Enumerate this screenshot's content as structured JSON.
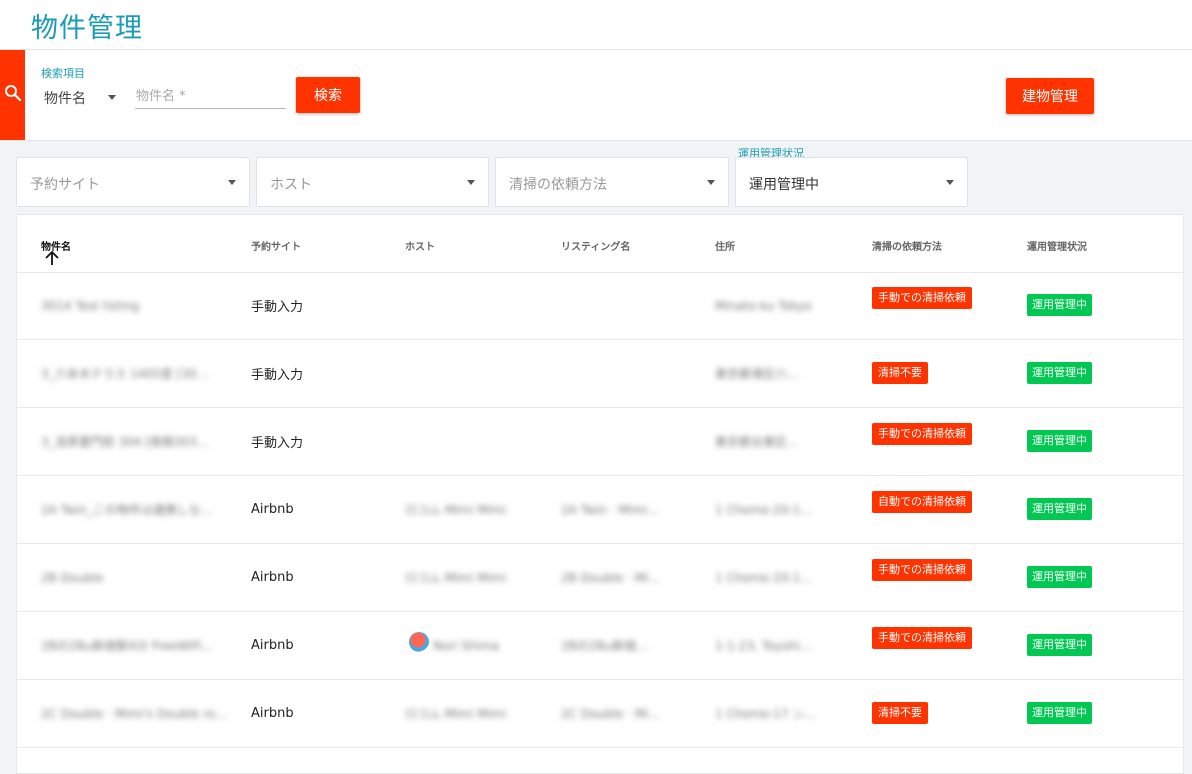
{
  "header": {
    "title": "物件管理"
  },
  "search": {
    "field_label": "検索項目",
    "field_value": "物件名",
    "input_placeholder": "物件名 *",
    "search_button": "検索",
    "building_button": "建物管理"
  },
  "filters": {
    "reservation_site": {
      "placeholder": "予約サイト"
    },
    "host": {
      "placeholder": "ホスト"
    },
    "cleaning_method": {
      "placeholder": "清掃の依頼方法"
    },
    "operation_status": {
      "label": "運用管理状況",
      "value": "運用管理中"
    }
  },
  "table": {
    "columns": [
      "物件名",
      "予約サイト",
      "ホスト",
      "リスティング名",
      "住所",
      "清掃の依頼方法",
      "運用管理状況"
    ],
    "rows": [
      {
        "property": "3014 Test listing",
        "site": "手動入力",
        "host": "",
        "listing": "",
        "address": "Minato-ku Tokyo",
        "cleaning": "手動での清掃依頼",
        "status": "運用管理中"
      },
      {
        "property": "3_六本木テラス 1405室 [30…",
        "site": "手動入力",
        "host": "",
        "listing": "",
        "address": "東京都港区六…",
        "cleaning": "清掃不要",
        "status": "運用管理中"
      },
      {
        "property": "3_浅草雷門前 304 [南側303…",
        "site": "手動入力",
        "host": "",
        "listing": "",
        "address": "東京都台東区…",
        "cleaning": "手動での清掃依頼",
        "status": "運用管理中"
      },
      {
        "property": "2A Twin_この物件は連携しな…",
        "site": "Airbnb",
        "host": "ロコム Mimi Mimi",
        "listing": "2A Twin · Mimi…",
        "address": "1 Chome-20-1…",
        "cleaning": "自動での清掃依頼",
        "status": "運用管理中"
      },
      {
        "property": "2B Double",
        "site": "Airbnb",
        "host": "ロコム Mimi Mimi",
        "listing": "2B Double · Mi…",
        "address": "1 Chome-20-1…",
        "cleaning": "手動での清掃依頼",
        "status": "運用管理中"
      },
      {
        "property": "2Bの2Bu新宿駅4分 FreeWiFi…",
        "site": "Airbnb",
        "host": "Nori Shima",
        "listing": "2Bの2Bu新宿…",
        "address": "1-1-23, Toyohi…",
        "cleaning": "手動での清掃依頼",
        "status": "運用管理中"
      },
      {
        "property": "2C Double · Mimi's Double ro…",
        "site": "Airbnb",
        "host": "ロコム Mimi Mimi",
        "listing": "2C Double · Mi…",
        "address": "1 Chome-17 ン…",
        "cleaning": "清掃不要",
        "status": "運用管理中"
      }
    ]
  },
  "colors": {
    "accent": "#1a9bb8",
    "primary_red": "#ff3300",
    "status_green": "#00c853"
  },
  "icons": {
    "search": "search-icon",
    "sort": "arrow-up-icon",
    "dropdown": "chevron-down-icon"
  }
}
